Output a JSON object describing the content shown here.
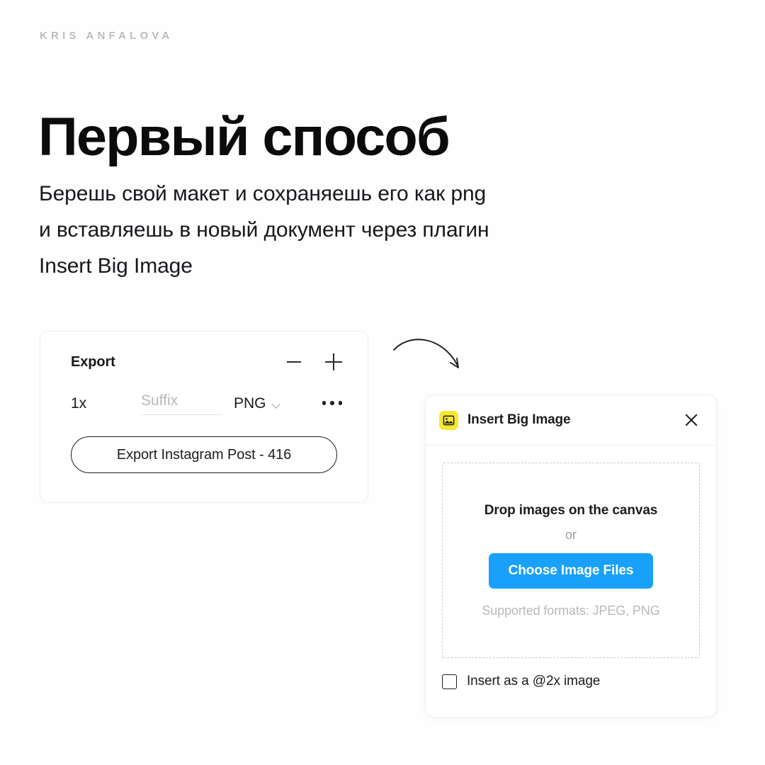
{
  "brand": "KRIS ANFALOVA",
  "headline": "Первый способ",
  "paragraph": {
    "line1": "Берешь свой макет и сохраняешь его как png",
    "line2": "и вставляешь в новый документ через плагин",
    "line3": "Insert Big Image"
  },
  "export_panel": {
    "title": "Export",
    "remove_icon": "minus-icon",
    "add_icon": "plus-icon",
    "scale": "1x",
    "suffix_value": "",
    "suffix_placeholder": "Suffix",
    "format": "PNG",
    "format_chevron_icon": "chevron-down-icon",
    "more_icon": "more-horizontal-icon",
    "export_button": "Export Instagram Post - 416"
  },
  "arrow": {
    "icon": "curved-arrow-icon",
    "color": "#1b1c1e"
  },
  "plugin": {
    "badge_icon": "image-icon",
    "badge_color": "#F7E733",
    "title": "Insert Big Image",
    "close_icon": "close-icon",
    "dropzone": {
      "title": "Drop images on the canvas",
      "or": "or",
      "button": "Choose Image Files",
      "button_color": "#18A0FB",
      "note": "Supported formats: JPEG, PNG"
    },
    "checkbox": {
      "label": "Insert as a @2x image",
      "checked": false
    }
  }
}
